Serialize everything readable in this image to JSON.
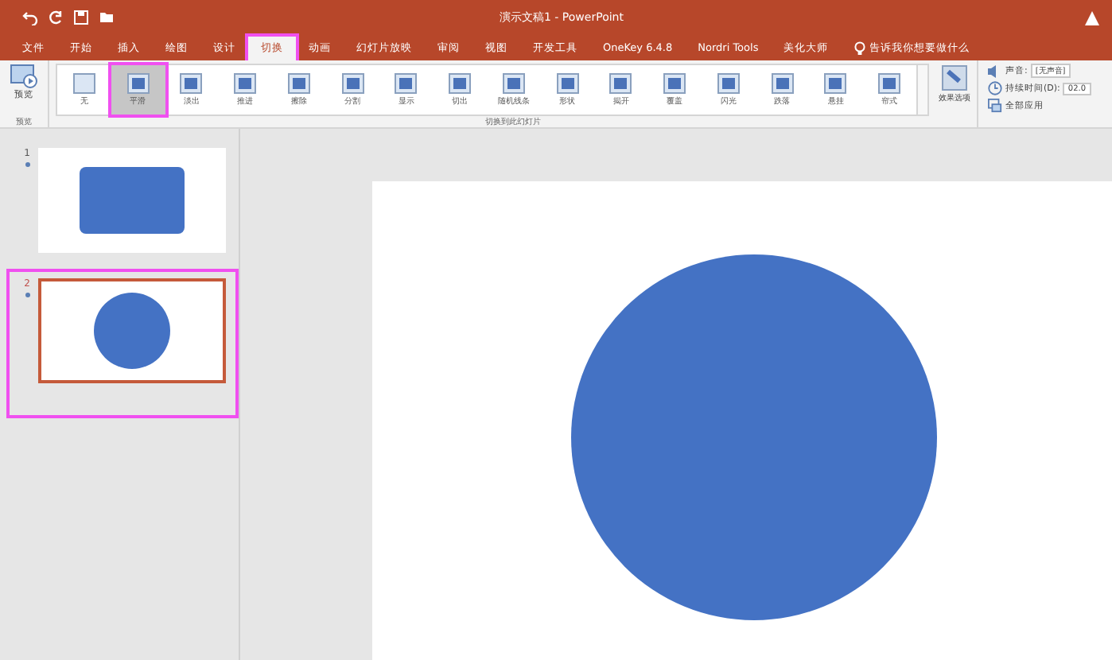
{
  "window": {
    "title": "演示文稿1 - PowerPoint"
  },
  "tabs": [
    {
      "label": "文件",
      "selected": false,
      "highlighted": false
    },
    {
      "label": "开始",
      "selected": false,
      "highlighted": false
    },
    {
      "label": "插入",
      "selected": false,
      "highlighted": false
    },
    {
      "label": "绘图",
      "selected": false,
      "highlighted": false
    },
    {
      "label": "设计",
      "selected": false,
      "highlighted": false
    },
    {
      "label": "切换",
      "selected": true,
      "highlighted": true
    },
    {
      "label": "动画",
      "selected": false,
      "highlighted": false
    },
    {
      "label": "幻灯片放映",
      "selected": false,
      "highlighted": false
    },
    {
      "label": "审阅",
      "selected": false,
      "highlighted": false
    },
    {
      "label": "视图",
      "selected": false,
      "highlighted": false
    },
    {
      "label": "开发工具",
      "selected": false,
      "highlighted": false
    },
    {
      "label": "OneKey 6.4.8",
      "selected": false,
      "highlighted": false
    },
    {
      "label": "Nordri Tools",
      "selected": false,
      "highlighted": false
    },
    {
      "label": "美化大师",
      "selected": false,
      "highlighted": false
    }
  ],
  "tell_me": {
    "placeholder": "告诉我你想要做什么"
  },
  "ribbon": {
    "preview": {
      "label": "预览",
      "group": "预览"
    },
    "transitions": [
      {
        "label": "无",
        "selected": false,
        "highlighted": false
      },
      {
        "label": "平滑",
        "selected": true,
        "highlighted": true
      },
      {
        "label": "淡出",
        "selected": false,
        "highlighted": false
      },
      {
        "label": "推进",
        "selected": false,
        "highlighted": false
      },
      {
        "label": "擦除",
        "selected": false,
        "highlighted": false
      },
      {
        "label": "分割",
        "selected": false,
        "highlighted": false
      },
      {
        "label": "显示",
        "selected": false,
        "highlighted": false
      },
      {
        "label": "切出",
        "selected": false,
        "highlighted": false
      },
      {
        "label": "随机线条",
        "selected": false,
        "highlighted": false
      },
      {
        "label": "形状",
        "selected": false,
        "highlighted": false
      },
      {
        "label": "揭开",
        "selected": false,
        "highlighted": false
      },
      {
        "label": "覆盖",
        "selected": false,
        "highlighted": false
      },
      {
        "label": "闪光",
        "selected": false,
        "highlighted": false
      },
      {
        "label": "跌落",
        "selected": false,
        "highlighted": false
      },
      {
        "label": "悬挂",
        "selected": false,
        "highlighted": false
      },
      {
        "label": "帘式",
        "selected": false,
        "highlighted": false
      }
    ],
    "group": "切换到此幻灯片",
    "effect_options": "效果选项",
    "sound": {
      "label": "声音:",
      "value": "[无声音]"
    },
    "duration": {
      "label": "持续时间(D):",
      "value": "02.0"
    },
    "apply_all": "全部应用"
  },
  "slides": [
    {
      "number": "1",
      "kind": "rectangle",
      "selected": false,
      "highlighted": false
    },
    {
      "number": "2",
      "kind": "circle",
      "selected": true,
      "highlighted": true
    }
  ],
  "canvas": {
    "kind": "circle"
  }
}
